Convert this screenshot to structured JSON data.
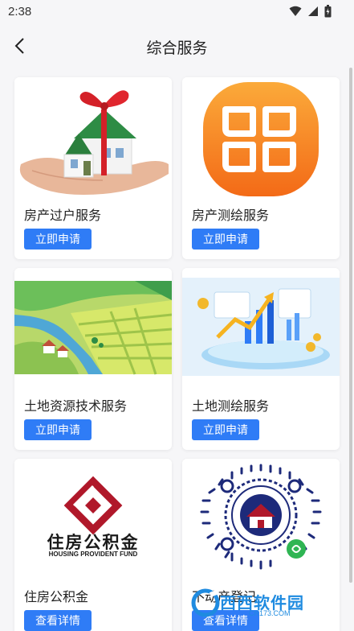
{
  "status_bar": {
    "time": "2:38"
  },
  "header": {
    "title": "综合服务"
  },
  "services": [
    {
      "title": "房产过户服务",
      "button": "立即申请"
    },
    {
      "title": "房产测绘服务",
      "button": "立即申请"
    },
    {
      "title": "土地资源技术服务",
      "button": "立即申请"
    },
    {
      "title": "土地测绘服务",
      "button": "立即申请"
    },
    {
      "title": "住房公积金",
      "button": "查看详情",
      "logo_cn": "住房公积金",
      "logo_en": "HOUSING PROVIDENT FUND"
    },
    {
      "title": "不动产登记",
      "button": "查看详情"
    }
  ],
  "watermark": {
    "text": "西西软件园",
    "url": "CR173.COM"
  },
  "colors": {
    "accent": "#2f7cf6",
    "background": "#f6f6f8",
    "fund_red": "#b0182a",
    "qr_blue": "#1d2a7a"
  }
}
